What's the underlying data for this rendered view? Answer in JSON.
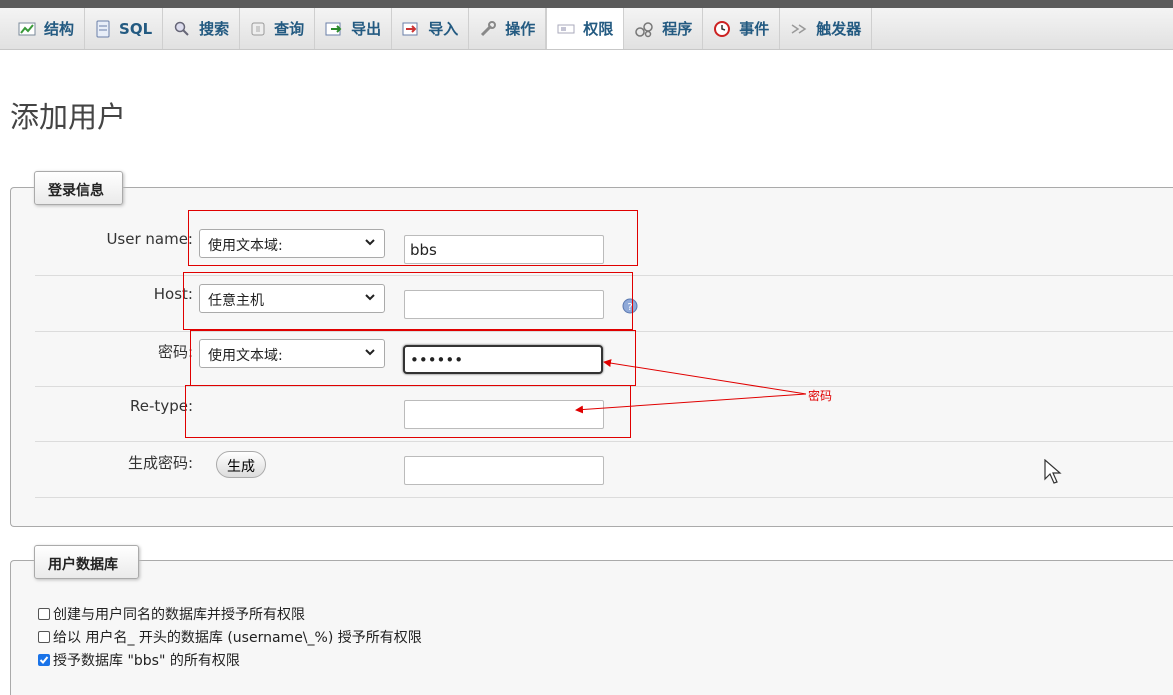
{
  "tabs": [
    {
      "label": "结构",
      "icon": "structure-icon"
    },
    {
      "label": "SQL",
      "icon": "sql-icon"
    },
    {
      "label": "搜索",
      "icon": "search-icon"
    },
    {
      "label": "查询",
      "icon": "query-icon"
    },
    {
      "label": "导出",
      "icon": "export-icon"
    },
    {
      "label": "导入",
      "icon": "import-icon"
    },
    {
      "label": "操作",
      "icon": "wrench-icon"
    },
    {
      "label": "权限",
      "icon": "privileges-icon",
      "active": true
    },
    {
      "label": "程序",
      "icon": "routines-icon"
    },
    {
      "label": "事件",
      "icon": "clock-icon"
    },
    {
      "label": "触发器",
      "icon": "triggers-icon"
    }
  ],
  "page": {
    "title": "添加用户"
  },
  "login": {
    "legend": "登录信息",
    "username": {
      "label": "User name:",
      "select": "使用文本域:",
      "value": "bbs"
    },
    "host": {
      "label": "Host:",
      "select": "任意主机",
      "value": ""
    },
    "password": {
      "label": "密码:",
      "select": "使用文本域:",
      "value": "••••••"
    },
    "retype": {
      "label": "Re-type:",
      "value": ""
    },
    "generate": {
      "label": "生成密码:",
      "button": "生成",
      "value": ""
    }
  },
  "annotation": {
    "text": "密码",
    "color": "#e00000"
  },
  "userdb": {
    "legend": "用户数据库",
    "options": [
      {
        "label": "创建与用户同名的数据库并授予所有权限",
        "checked": false
      },
      {
        "label": "给以 用户名_ 开头的数据库 (username\\_%) 授予所有权限",
        "checked": false
      },
      {
        "label": "授予数据库 \"bbs\" 的所有权限",
        "checked": true
      }
    ]
  },
  "colors": {
    "accent": "#235a81",
    "annotation": "#e00000",
    "checkbox": "#1a73e8"
  }
}
